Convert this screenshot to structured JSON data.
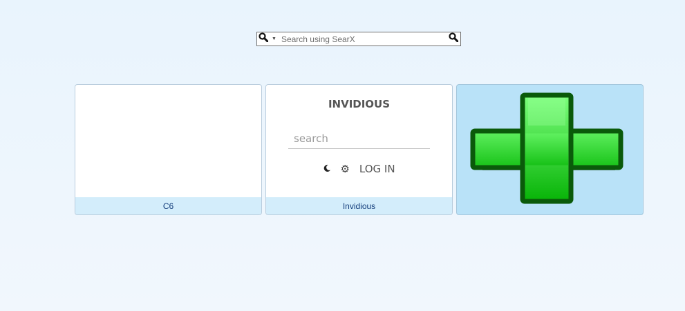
{
  "search": {
    "placeholder": "Search using SearX",
    "engine_icon": "magnifier-icon",
    "submit_icon": "magnifier-icon"
  },
  "tiles": [
    {
      "caption": "C6"
    },
    {
      "caption": "Invidious",
      "title": "INVIDIOUS",
      "search_placeholder": "search",
      "theme_icon": "moon-icon",
      "settings_icon": "gear-icon",
      "login_label": "LOG IN"
    },
    {
      "icon": "green-plus-icon"
    }
  ],
  "colors": {
    "background": "#eaf4fd",
    "caption_bg": "#d3edfb",
    "caption_text": "#123c7a",
    "add_tile_bg": "#b9e2f8",
    "plus_green": "#22c522",
    "plus_outline": "#0a5a0a"
  }
}
